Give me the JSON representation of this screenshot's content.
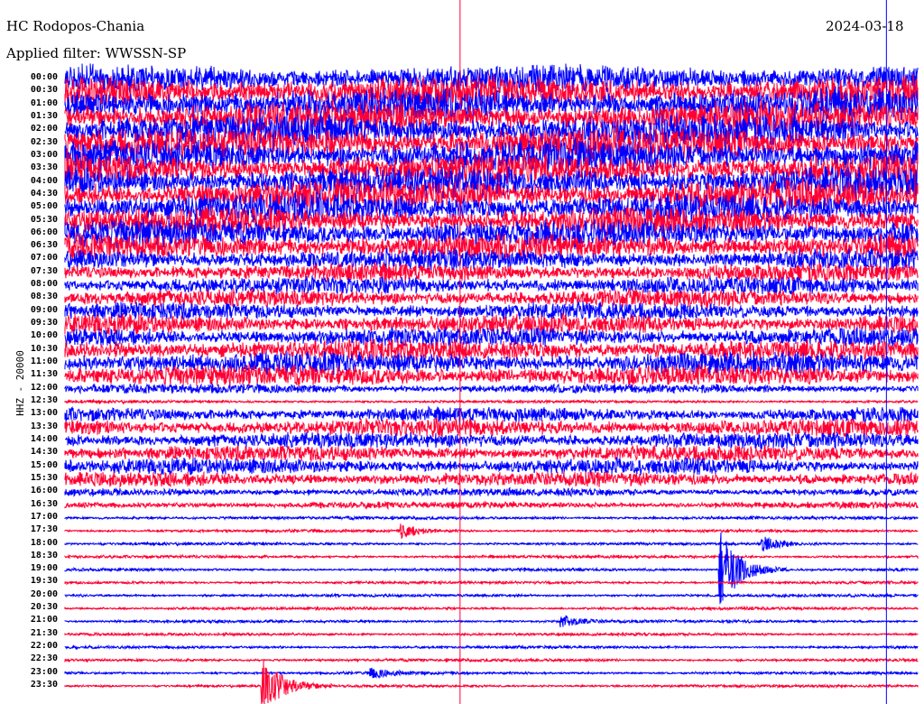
{
  "chart_data": {
    "type": "line",
    "title": "HC Rodopos-Chania",
    "subtitle": "Applied filter: WWSSN-SP",
    "date": "2024-03-18",
    "ylabel": "HHZ - 20000",
    "xlabel": "",
    "minutes_per_line": 30,
    "colors": [
      "#0000ff",
      "#ff0033"
    ],
    "row_labels": [
      "00:00",
      "00:30",
      "01:00",
      "01:30",
      "02:00",
      "02:30",
      "03:00",
      "03:30",
      "04:00",
      "04:30",
      "05:00",
      "05:30",
      "06:00",
      "06:30",
      "07:00",
      "07:30",
      "08:00",
      "08:30",
      "09:00",
      "09:30",
      "10:00",
      "10:30",
      "11:00",
      "11:30",
      "12:00",
      "12:30",
      "13:00",
      "13:30",
      "14:00",
      "14:30",
      "15:00",
      "15:30",
      "16:00",
      "16:30",
      "17:00",
      "17:30",
      "18:00",
      "18:30",
      "19:00",
      "19:30",
      "20:00",
      "20:30",
      "21:00",
      "21:30",
      "22:00",
      "22:30",
      "23:00",
      "23:30"
    ],
    "noise_amplitude_rel": [
      1.6,
      1.8,
      1.9,
      1.9,
      1.9,
      1.9,
      1.9,
      1.8,
      1.8,
      1.8,
      1.7,
      1.6,
      1.6,
      1.5,
      1.2,
      1.0,
      1.0,
      1.0,
      1.0,
      1.1,
      1.1,
      1.2,
      1.3,
      1.2,
      0.5,
      0.1,
      0.8,
      1.0,
      0.9,
      0.9,
      0.9,
      0.8,
      0.4,
      0.35,
      0.12,
      0.1,
      0.1,
      0.1,
      0.1,
      0.1,
      0.1,
      0.1,
      0.1,
      0.1,
      0.1,
      0.1,
      0.1,
      0.1
    ],
    "events": [
      {
        "row": "17:30",
        "minute": 11.8,
        "amplitude_rel": 0.6
      },
      {
        "row": "18:00",
        "minute": 24.5,
        "amplitude_rel": 0.6
      },
      {
        "row": "19:00",
        "minute": 23.0,
        "amplitude_rel": 3.5
      },
      {
        "row": "21:00",
        "minute": 17.4,
        "amplitude_rel": 0.6
      },
      {
        "row": "23:00",
        "minute": 10.7,
        "amplitude_rel": 0.4
      },
      {
        "row": "23:30",
        "minute": 6.9,
        "amplitude_rel": 2.5
      }
    ],
    "vertical_markers_minute": [
      {
        "minute": 13.9,
        "color": "#ff0033"
      },
      {
        "minute": 28.9,
        "color": "#0000ff"
      }
    ]
  }
}
